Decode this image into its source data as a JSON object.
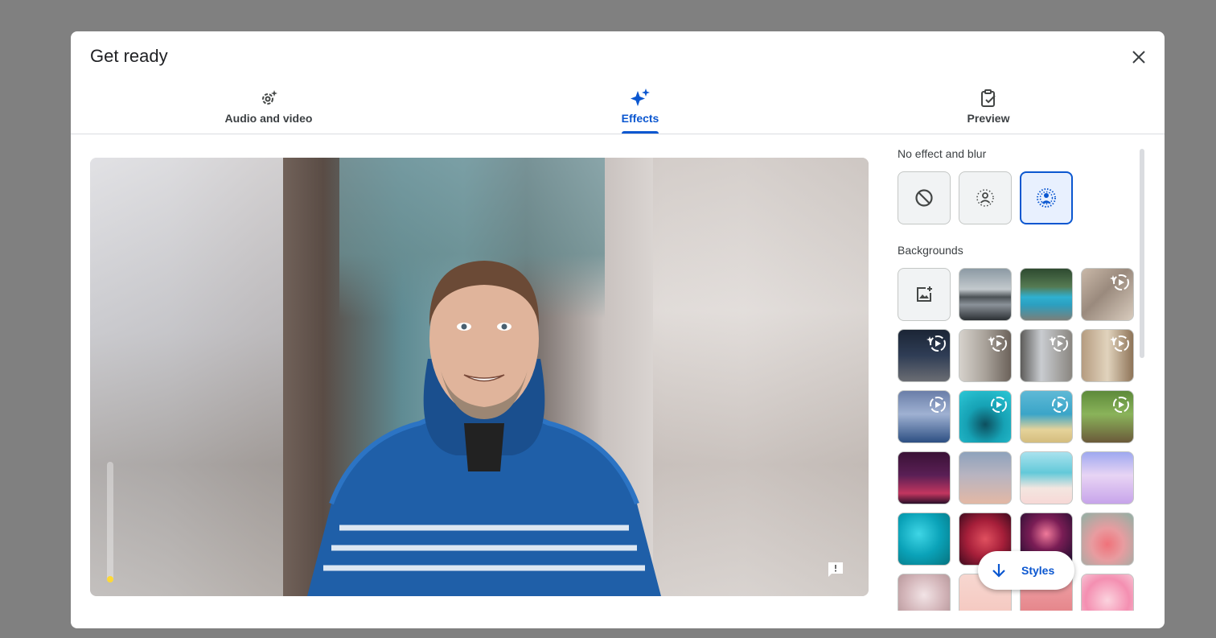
{
  "dialog": {
    "title": "Get ready",
    "close_icon": "close-icon"
  },
  "tabs": [
    {
      "label": "Audio and video",
      "icon": "settings-sparkle-icon",
      "active": false
    },
    {
      "label": "Effects",
      "icon": "sparkle-icon",
      "active": true
    },
    {
      "label": "Preview",
      "icon": "clipboard-check-icon",
      "active": false
    }
  ],
  "video": {
    "mic_level": 0.05,
    "feedback_icon": "feedback-icon"
  },
  "effects": {
    "section_title": "No effect and blur",
    "items": [
      {
        "icon": "no-effect-icon",
        "selected": false
      },
      {
        "icon": "slight-blur-icon",
        "selected": false
      },
      {
        "icon": "blur-icon",
        "selected": true
      }
    ]
  },
  "backgrounds": {
    "section_title": "Backgrounds",
    "upload_icon": "add-image-icon",
    "animated_icon": "animated-sparkle-icon"
  },
  "styles_button": {
    "label": "Styles",
    "icon": "arrow-down-icon"
  },
  "colors": {
    "accent": "#0b57d0",
    "overlay": "#808080",
    "tile_border": "#c4c7c5"
  }
}
